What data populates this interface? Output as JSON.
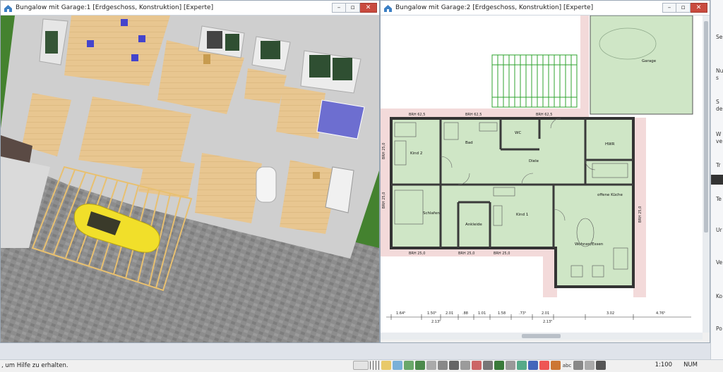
{
  "left_window": {
    "title": "Bungalow mit Garage:1 [Erdgeschoss, Konstruktion] [Experte]"
  },
  "right_window": {
    "title": "Bungalow mit Garage:2 [Erdgeschoss, Konstruktion] [Experte]",
    "rooms": {
      "garage": "Garage",
      "kind2": "Kind 2",
      "bad": "Bad",
      "wc": "WC",
      "diele": "Diele",
      "hwr": "HWR",
      "schlafen": "Schlafen",
      "ankleide": "Ankleide",
      "kind1": "Kind 1",
      "kueche": "offene Küche",
      "wohnen": "Wohnen/Essen"
    },
    "wall_tags": {
      "t1": "BRH 62,5",
      "t2": "BRH 62,5",
      "t3": "BRH 62,5",
      "t4": "BRH 25,0",
      "t5": "BRH 25,0",
      "t6": "BRH 25,0",
      "t7": "BRH 25,0",
      "t8": "BRH 25,0",
      "t9": "BRH 25,0"
    },
    "dimensions": {
      "d1": "1.64⁵",
      "d2": "1.50⁵",
      "d3": "2.01",
      "d4": ".88",
      "d5": "1.01",
      "d6": "1.58",
      "d7": ".73⁵",
      "d8": "2.01",
      "d9": "3.02",
      "d10": "4.76⁵",
      "d11": "2.13⁵",
      "d12": "2.13⁵"
    }
  },
  "status_bar": {
    "hint": ", um Hilfe zu erhalten.",
    "scale": "1:100",
    "mode": "NUM"
  },
  "right_panel": {
    "labels": [
      "Se",
      "Nu",
      "s",
      "S",
      "de",
      "W",
      "ve",
      "Tr",
      "Te",
      "Ur",
      "Ve",
      "Ko",
      "Po"
    ]
  },
  "colors": {
    "grass": "#3f7f2c",
    "floor_wood": "#e9c98f",
    "paving": "#8a8a8a",
    "room_fill": "#cfe6c6",
    "wall": "#444444",
    "terrace": "#f2d6d6",
    "car": "#f2e233"
  }
}
